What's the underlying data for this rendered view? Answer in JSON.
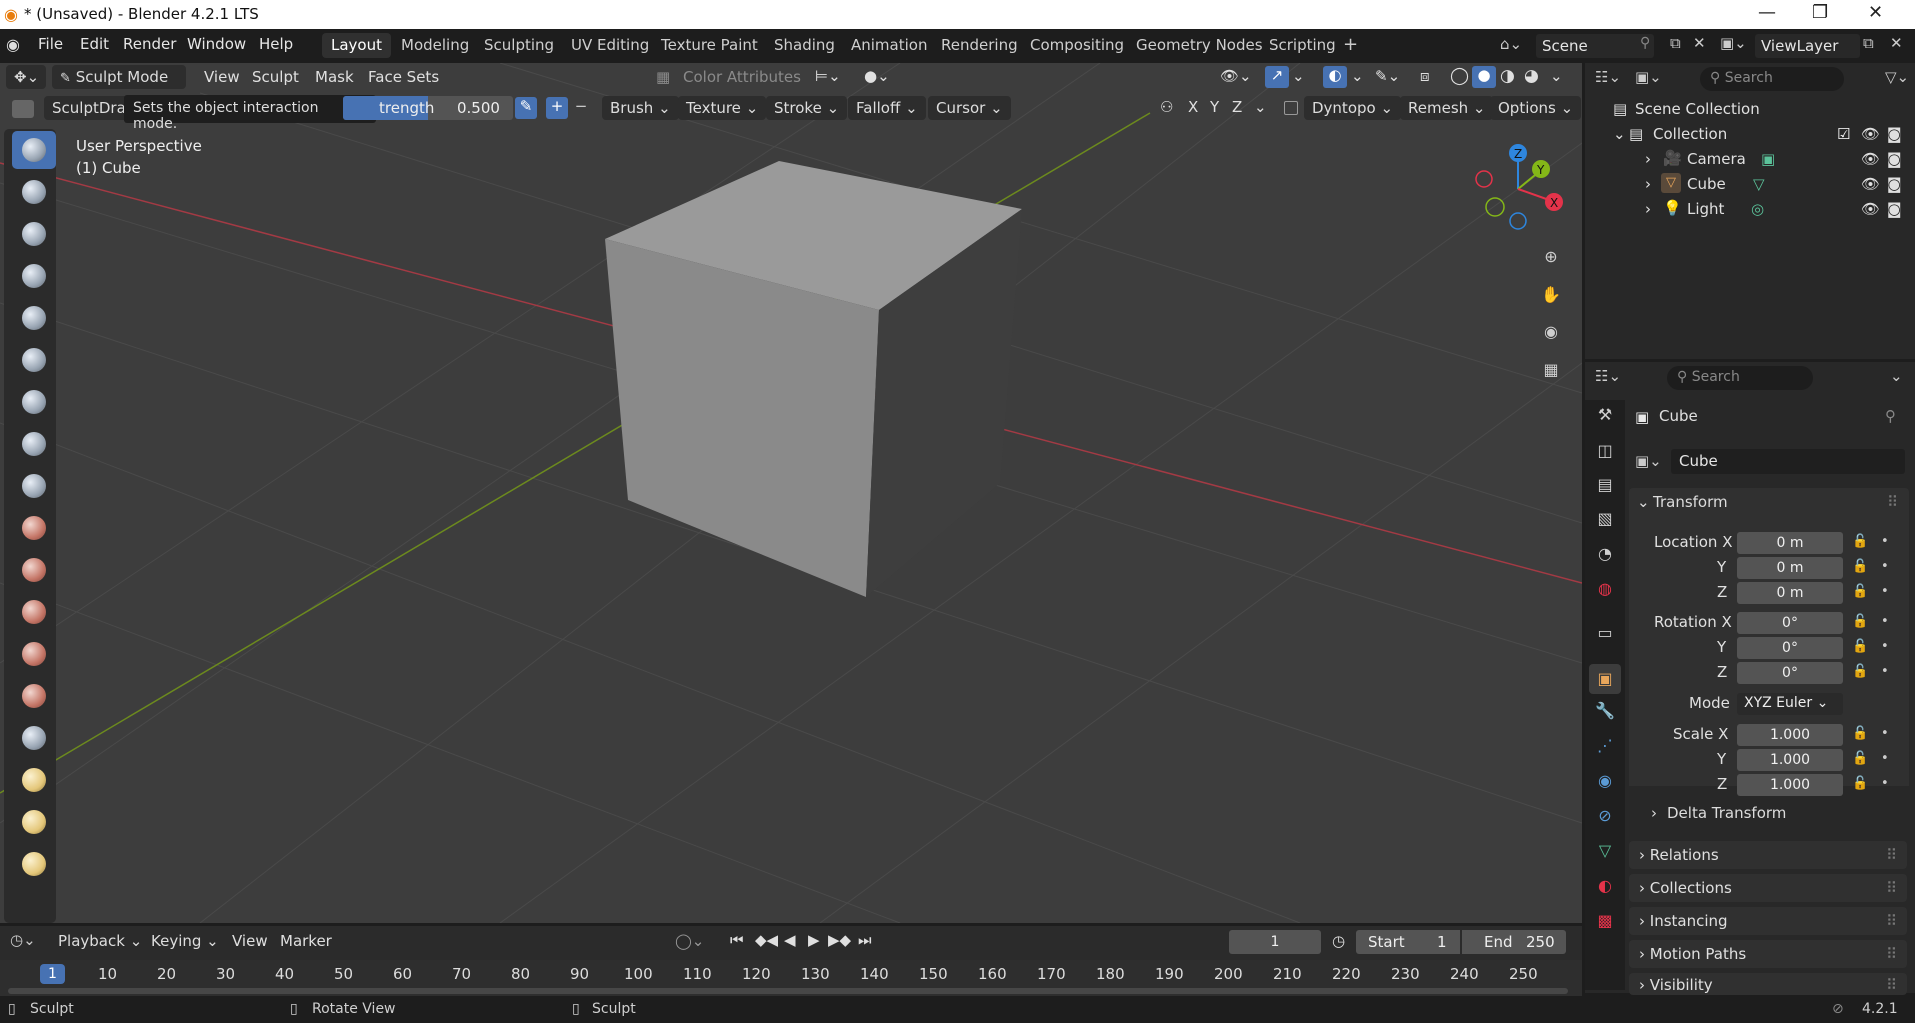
{
  "window": {
    "title": "* (Unsaved) - Blender 4.2.1 LTS",
    "minimize": "—",
    "maximize": "❐",
    "close": "✕"
  },
  "menu": {
    "items": [
      "File",
      "Edit",
      "Render",
      "Window",
      "Help"
    ]
  },
  "workspaces": [
    "Layout",
    "Modeling",
    "Sculpting",
    "UV Editing",
    "Texture Paint",
    "Shading",
    "Animation",
    "Rendering",
    "Compositing",
    "Geometry Nodes",
    "Scripting"
  ],
  "scene": {
    "scene_name": "Scene",
    "view_layer": "ViewLayer"
  },
  "viewport_header": {
    "mode": "Sculpt Mode",
    "menus": [
      "View",
      "Sculpt",
      "Mask",
      "Face Sets"
    ],
    "color_attributes": "Color Attributes",
    "brush_name": "SculptDraw",
    "tooltip": "Sets the object interaction mode.",
    "strength_label": "trength",
    "strength_value": "0.500",
    "brush_menus": [
      "Brush",
      "Texture",
      "Stroke",
      "Falloff",
      "Cursor"
    ],
    "symmetry": [
      "X",
      "Y",
      "Z"
    ],
    "dyntopo": "Dyntopo",
    "remesh": "Remesh",
    "options": "Options"
  },
  "viewport": {
    "perspective": "User Perspective",
    "object": "(1) Cube"
  },
  "outliner": {
    "search_placeholder": "Search",
    "scene_collection": "Scene Collection",
    "collection": "Collection",
    "objects": [
      {
        "name": "Camera",
        "icon": "camera-icon",
        "color": "#e8a65b"
      },
      {
        "name": "Cube",
        "icon": "mesh-icon",
        "color": "#e8a65b"
      },
      {
        "name": "Light",
        "icon": "light-icon",
        "color": "#e8a65b"
      }
    ]
  },
  "properties": {
    "search_placeholder": "Search",
    "object_name": "Cube",
    "data_name": "Cube",
    "transform_label": "Transform",
    "location_label": "Location X",
    "rotation_label": "Rotation X",
    "scale_label": "Scale X",
    "y_label": "Y",
    "z_label": "Z",
    "location": [
      "0 m",
      "0 m",
      "0 m"
    ],
    "rotation": [
      "0°",
      "0°",
      "0°"
    ],
    "scale": [
      "1.000",
      "1.000",
      "1.000"
    ],
    "mode_label": "Mode",
    "mode_value": "XYZ Euler",
    "delta_transform": "Delta Transform",
    "panels": [
      "Relations",
      "Collections",
      "Instancing",
      "Motion Paths",
      "Visibility"
    ]
  },
  "timeline": {
    "menus": [
      "Playback",
      "Keying",
      "View",
      "Marker"
    ],
    "current_frame": "1",
    "start_label": "Start",
    "start_value": "1",
    "end_label": "End",
    "end_value": "250",
    "ruler": [
      "1",
      "10",
      "20",
      "30",
      "40",
      "50",
      "60",
      "70",
      "80",
      "90",
      "100",
      "110",
      "120",
      "130",
      "140",
      "150",
      "160",
      "170",
      "180",
      "190",
      "200",
      "210",
      "220",
      "230",
      "240",
      "250"
    ]
  },
  "statusbar": {
    "left": "Sculpt",
    "middle": "Rotate View",
    "right": "Sculpt",
    "version": "4.2.1"
  },
  "colors": {
    "accent": "#4772b3",
    "x_axis": "#e4334a",
    "y_axis": "#84b718",
    "z_axis": "#2e86de"
  }
}
